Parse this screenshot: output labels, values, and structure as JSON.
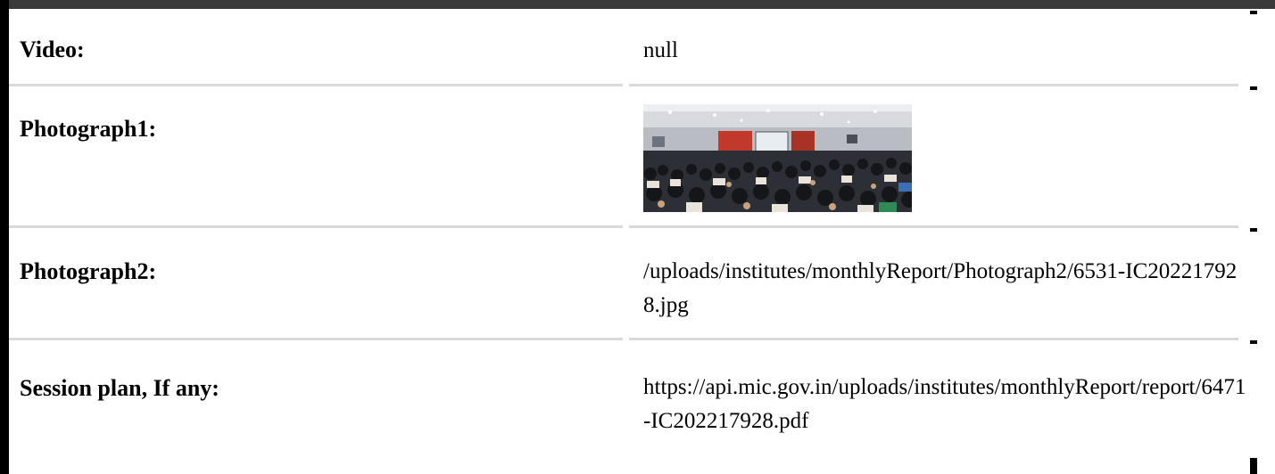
{
  "rows": [
    {
      "label": "Video:",
      "value": "null"
    },
    {
      "label": "Photograph1:",
      "value": ""
    },
    {
      "label": "Photograph2:",
      "value": "/uploads/institutes/monthlyReport/Photograph2/6531-IC202217928.jpg"
    },
    {
      "label": "Session plan, If any:",
      "value": "https://api.mic.gov.in/uploads/institutes/monthlyReport/report/6471-IC202217928.pdf"
    }
  ],
  "photograph1": {
    "icon": "auditorium-photo"
  }
}
